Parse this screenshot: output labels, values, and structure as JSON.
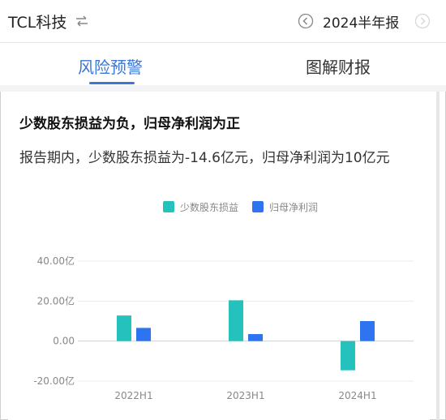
{
  "header": {
    "company": "TCL科技",
    "period": "2024半年报",
    "icons": {
      "swap": "swap-arrows-icon",
      "prev": "chevron-left-circle-icon",
      "next": "chevron-right-circle-icon"
    }
  },
  "tabs": [
    {
      "label": "风险预警",
      "active": true
    },
    {
      "label": "图解财报",
      "active": false
    }
  ],
  "card": {
    "title": "少数股东损益为负，归母净利润为正",
    "description": "报告期内，少数股东损益为-14.6亿元，归母净利润为10亿元"
  },
  "colors": {
    "accent": "#3a77d8",
    "minority": "#25c2bd",
    "parent": "#2e74f0"
  },
  "chart_data": {
    "type": "bar",
    "categories": [
      "2022H1",
      "2023H1",
      "2024H1"
    ],
    "series": [
      {
        "name": "少数股东损益",
        "values": [
          12.8,
          20.4,
          -14.6
        ]
      },
      {
        "name": "归母净利润",
        "values": [
          6.6,
          3.5,
          10.0
        ]
      }
    ],
    "ylim": [
      -20,
      40
    ],
    "yticks": [
      "40.00亿",
      "20.00亿",
      "0.00",
      "-20.00亿"
    ],
    "grid": true,
    "legend": "top-center"
  }
}
